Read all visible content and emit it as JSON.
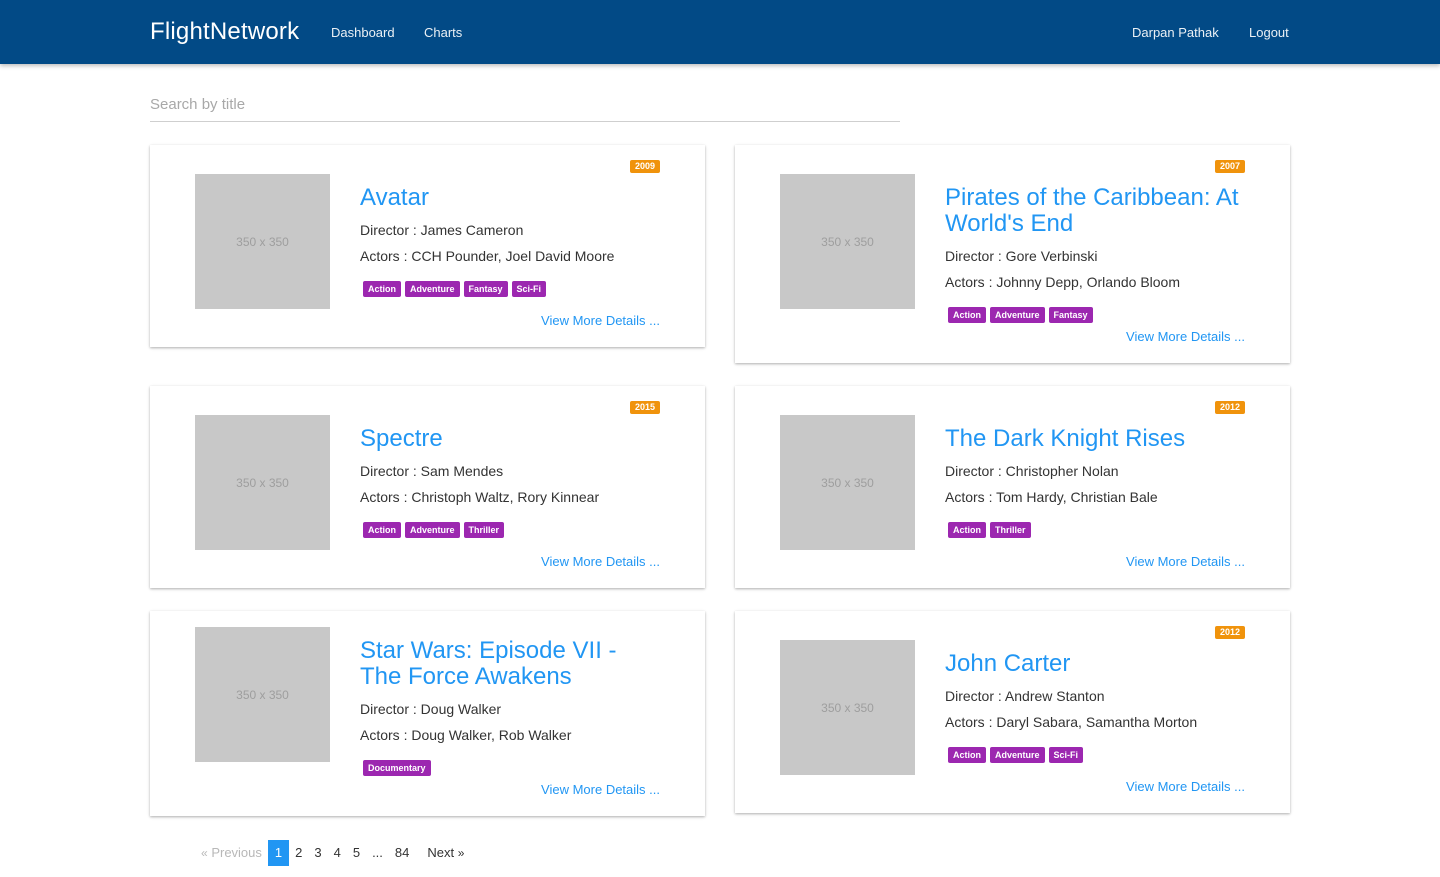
{
  "navbar": {
    "brand": "FlightNetwork",
    "links": [
      "Dashboard",
      "Charts"
    ],
    "user": "Darpan Pathak",
    "logout": "Logout"
  },
  "search": {
    "placeholder": "Search by title",
    "value": ""
  },
  "poster_placeholder": "350 x 350",
  "labels": {
    "director_prefix": "Director : ",
    "actors_prefix": "Actors : ",
    "view_details": "View More Details ..."
  },
  "movies": [
    {
      "title": "Avatar",
      "year": "2009",
      "director": "Director : James Cameron",
      "actors": "Actors : CCH Pounder, Joel David Moore",
      "genres": [
        "Action",
        "Adventure",
        "Fantasy",
        "Sci-Fi"
      ],
      "details": "View More Details ..."
    },
    {
      "title": "Pirates of the Caribbean: At World's End",
      "year": "2007",
      "director": "Director : Gore Verbinski",
      "actors": "Actors : Johnny Depp, Orlando Bloom",
      "genres": [
        "Action",
        "Adventure",
        "Fantasy"
      ],
      "details": "View More Details ..."
    },
    {
      "title": "Spectre",
      "year": "2015",
      "director": "Director : Sam Mendes",
      "actors": "Actors : Christoph Waltz, Rory Kinnear",
      "genres": [
        "Action",
        "Adventure",
        "Thriller"
      ],
      "details": "View More Details ..."
    },
    {
      "title": "The Dark Knight Rises",
      "year": "2012",
      "director": "Director : Christopher Nolan",
      "actors": "Actors : Tom Hardy, Christian Bale",
      "genres": [
        "Action",
        "Thriller"
      ],
      "details": "View More Details ..."
    },
    {
      "title": "Star Wars: Episode VII - The Force Awakens",
      "year": "",
      "director": "Director : Doug Walker",
      "actors": "Actors : Doug Walker, Rob Walker",
      "genres": [
        "Documentary"
      ],
      "details": "View More Details ..."
    },
    {
      "title": "John Carter",
      "year": "2012",
      "director": "Director : Andrew Stanton",
      "actors": "Actors : Daryl Sabara, Samantha Morton",
      "genres": [
        "Action",
        "Adventure",
        "Sci-Fi"
      ],
      "details": "View More Details ..."
    }
  ],
  "pagination": {
    "previous": "Previous",
    "next": "Next",
    "prev_arrow": "«",
    "next_arrow": "»",
    "pages": [
      "1",
      "2",
      "3",
      "4",
      "5",
      "...",
      "84"
    ],
    "current": "1"
  },
  "colors": {
    "navbar": "#024a86",
    "link": "#2196f3",
    "genre_badge": "#9c27b0",
    "year_badge": "#f0930c"
  }
}
